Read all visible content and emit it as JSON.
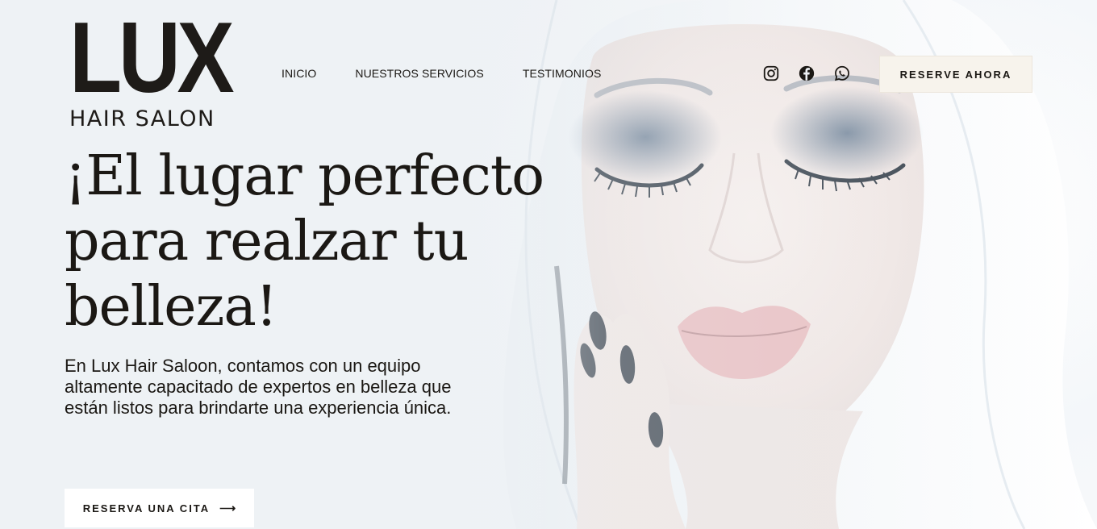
{
  "brand": {
    "logo_main": "LUX",
    "logo_sub": "HAIR SALON"
  },
  "nav": {
    "items": [
      "INICIO",
      "NUESTROS SERVICIOS",
      "TESTIMONIOS"
    ]
  },
  "social": {
    "icons": [
      "instagram-icon",
      "facebook-icon",
      "whatsapp-icon"
    ]
  },
  "header_cta": {
    "label": "RESERVE AHORA"
  },
  "hero": {
    "headline": "¡El lugar perfecto para realzar tu belleza!",
    "intro": "En Lux Hair Saloon, contamos con un equipo altamente capacitado de expertos en belleza que están listos para brindarte una experiencia única.",
    "cta_label": "RESERVA UNA CITA",
    "cta_icon": "arrow-right-icon"
  },
  "colors": {
    "text": "#1b1814",
    "cta_top_bg": "#f7f3ec",
    "cta_hero_bg": "#ffffff",
    "page_bg": "#eef1f4"
  }
}
